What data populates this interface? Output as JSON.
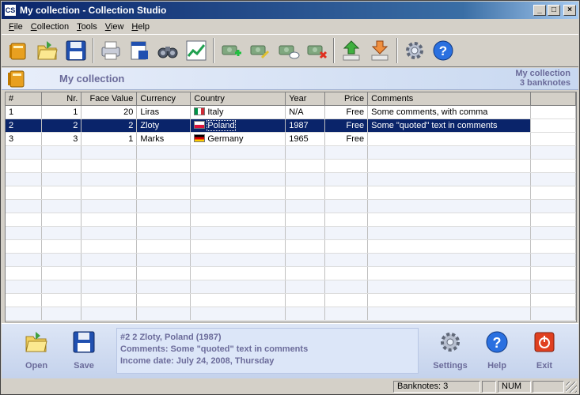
{
  "window": {
    "app_icon": "CS",
    "title": "My collection - Collection Studio",
    "buttons": {
      "minimize": "_",
      "maximize": "□",
      "close": "×"
    }
  },
  "menu": [
    {
      "label": "File",
      "key": "F"
    },
    {
      "label": "Collection",
      "key": "C"
    },
    {
      "label": "Tools",
      "key": "T"
    },
    {
      "label": "View",
      "key": "V"
    },
    {
      "label": "Help",
      "key": "H"
    }
  ],
  "toolbar": {
    "items": [
      "new-collection-icon",
      "open-folder-icon",
      "save-disk-icon",
      "print-icon",
      "print-preview-icon",
      "find-binoculars-icon",
      "statistics-chart-icon",
      "add-item-icon",
      "edit-item-icon",
      "comment-item-icon",
      "delete-item-icon",
      "upload-icon",
      "download-icon",
      "settings-gear-icon",
      "help-icon"
    ]
  },
  "header": {
    "title": "My collection",
    "right_line1": "My collection",
    "right_line2": "3 banknotes"
  },
  "table": {
    "columns": [
      "#",
      "Nr.",
      "Face Value",
      "Currency",
      "Country",
      "Year",
      "Price",
      "Comments"
    ],
    "rows": [
      {
        "num": "1",
        "nr": "1",
        "face": "20",
        "currency": "Liras",
        "country": "Italy",
        "flag": "italy",
        "year": "N/A",
        "price": "Free",
        "comments": "Some comments, with comma"
      },
      {
        "num": "2",
        "nr": "2",
        "face": "2",
        "currency": "Zloty",
        "country": "Poland",
        "flag": "poland",
        "year": "1987",
        "price": "Free",
        "comments": "Some \"quoted\" text in comments"
      },
      {
        "num": "3",
        "nr": "3",
        "face": "1",
        "currency": "Marks",
        "country": "Germany",
        "flag": "germany",
        "year": "1965",
        "price": "Free",
        "comments": ""
      }
    ],
    "selected_index": 1
  },
  "bottom": {
    "open_label": "Open",
    "save_label": "Save",
    "settings_label": "Settings",
    "help_label": "Help",
    "exit_label": "Exit",
    "info_line1": "#2 2 Zloty, Poland (1987)",
    "info_line2": "Comments: Some \"quoted\" text in comments",
    "info_line3": "Income date: July 24, 2008, Thursday"
  },
  "status": {
    "banknotes": "Banknotes: 3",
    "num": "NUM"
  },
  "colors": {
    "selection": "#0a246a",
    "accent_text": "#6b6b9a",
    "titlebar_start": "#0a246a"
  }
}
